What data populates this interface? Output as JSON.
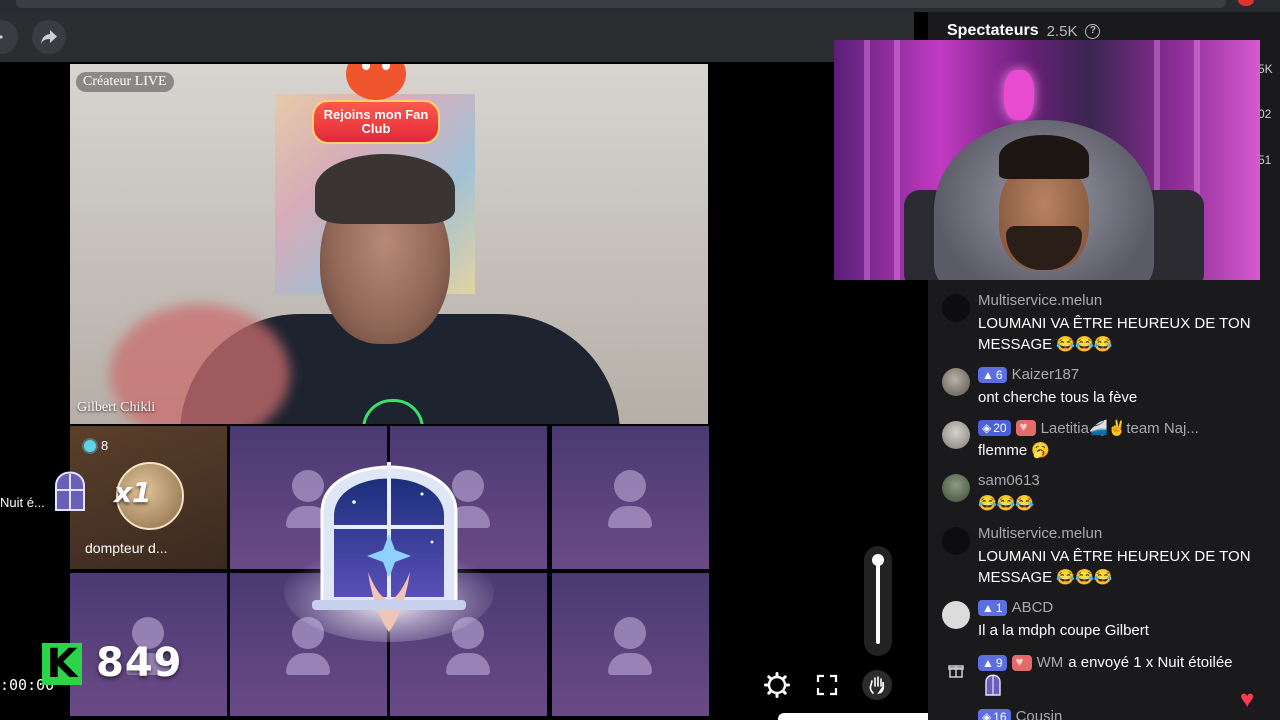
{
  "toolbar": {
    "share_icon": "share-arrow-icon"
  },
  "left_overlay": {
    "gift_label": "Nuit é...",
    "timer": ":00:00",
    "badge_letter": "K",
    "count": "849"
  },
  "main_video": {
    "tag": "Créateur LIVE",
    "creator_name": "Gilbert Chikli",
    "fan_club": "Rejoins mon Fan Club"
  },
  "guests": {
    "first": {
      "count": "8",
      "multiplier": "x1",
      "name": "dompteur d..."
    }
  },
  "right_panel": {
    "viewers_label": "Spectateurs",
    "viewers_count": "2.5K",
    "side_numbers": [
      "5K",
      "02",
      "51"
    ]
  },
  "chat": [
    {
      "user": "Multiservice.melun",
      "text": "LOUMANI VA ÊTRE HEUREUX DE TON MESSAGE 😂😂😂"
    },
    {
      "user": "Kaizer187",
      "level": "6",
      "text": "ont cherche tous la fève"
    },
    {
      "user": "Laetitia🚄✌️team Naj...",
      "level": "20",
      "text": "flemme 🥱"
    },
    {
      "user": "sam0613",
      "text": "😂😂😂"
    },
    {
      "user": "Multiservice.melun",
      "text": "LOUMANI VA ÊTRE HEUREUX DE TON MESSAGE 😂😂😂"
    },
    {
      "user": "ABCD",
      "level": "1",
      "text": "Il a la mdph coupe Gilbert"
    },
    {
      "user": "WM",
      "level": "9",
      "text": "a envoyé 1 x Nuit étoilée"
    },
    {
      "user": "Cousin",
      "level": "16",
      "text": ""
    }
  ],
  "colors": {
    "accent_green": "#2bd448",
    "level_badge": "#5d6fe0",
    "heart": "#ff3b4f"
  }
}
